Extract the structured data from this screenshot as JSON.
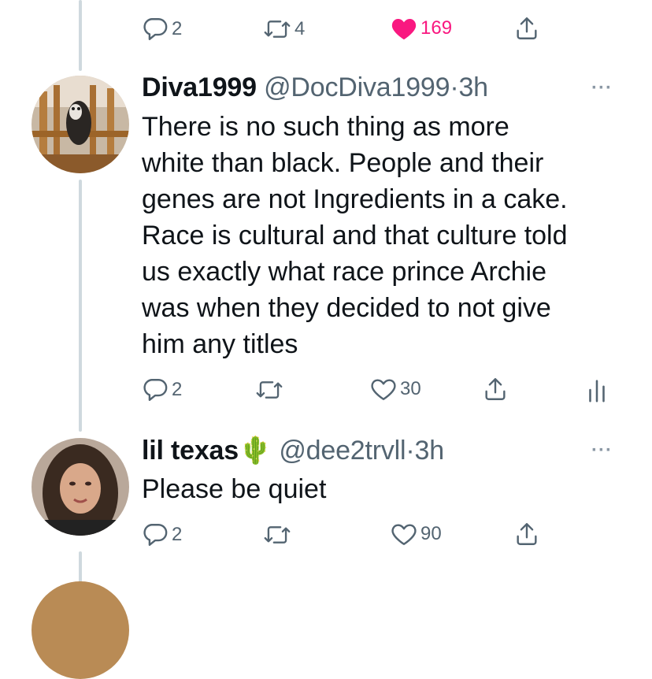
{
  "top_actions": {
    "reply_count": "2",
    "retweet_count": "4",
    "like_count": "169"
  },
  "tweets": [
    {
      "name": "Diva1999",
      "handle": "@DocDiva1999",
      "dot": "·",
      "time": "3h",
      "text_lines": [
        "There is no such thing as more",
        "white than black. People and their",
        "genes are not Ingredients in a cake.",
        "Race is cultural and that culture told",
        "us exactly what race  prince Archie",
        "was when they decided to not give",
        "him any titles"
      ],
      "reply_count": "2",
      "like_count": "30"
    },
    {
      "name": "lil texas",
      "emoji": "🌵",
      "handle": "@dee2trvll",
      "dot": "·",
      "time": "3h",
      "text": "Please be quiet",
      "reply_count": "2",
      "like_count": "90"
    }
  ],
  "more_label": "···",
  "colors": {
    "like_active": "#f91880",
    "muted": "#536471",
    "thread": "#cfd9de"
  }
}
